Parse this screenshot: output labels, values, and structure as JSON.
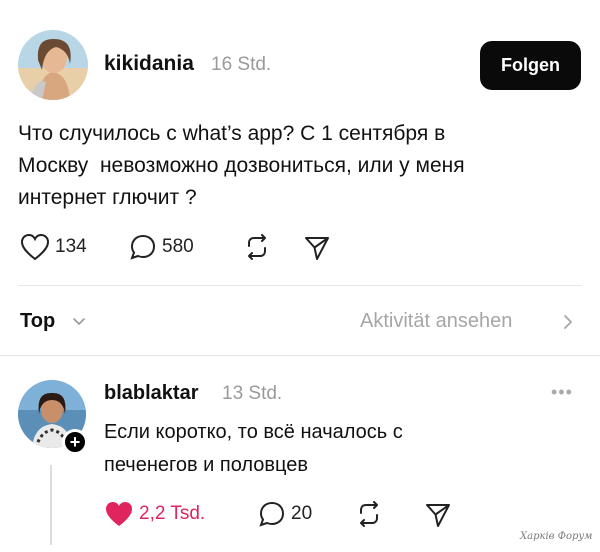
{
  "post": {
    "username": "kikidania",
    "time": "16 Std.",
    "follow_label": "Folgen",
    "text": "Что случилось с what’s app? С 1 сентября в\nМоскву  невозможно дозвониться, или у меня\nинтернет глючит ?",
    "likes": "134",
    "comments": "580"
  },
  "sort": {
    "label": "Top",
    "activity_label": "Aktivität ansehen"
  },
  "reply": {
    "username": "blablaktar",
    "time": "13 Std.",
    "text": "Если коротко, то всё началось с\nпеченегов и половцев",
    "likes": "2,2 Tsd.",
    "comments": "20",
    "more": "•••",
    "plus": "+"
  },
  "watermark": "Харків Форум",
  "icons": [
    "heart-icon",
    "comment-icon",
    "repost-icon",
    "share-icon",
    "chevron-down-icon",
    "chevron-right-icon",
    "more-icon",
    "plus-icon"
  ],
  "colors": {
    "liked": "#e0245e",
    "muted": "#9a9a9a",
    "button_bg": "#0a0a0a"
  }
}
